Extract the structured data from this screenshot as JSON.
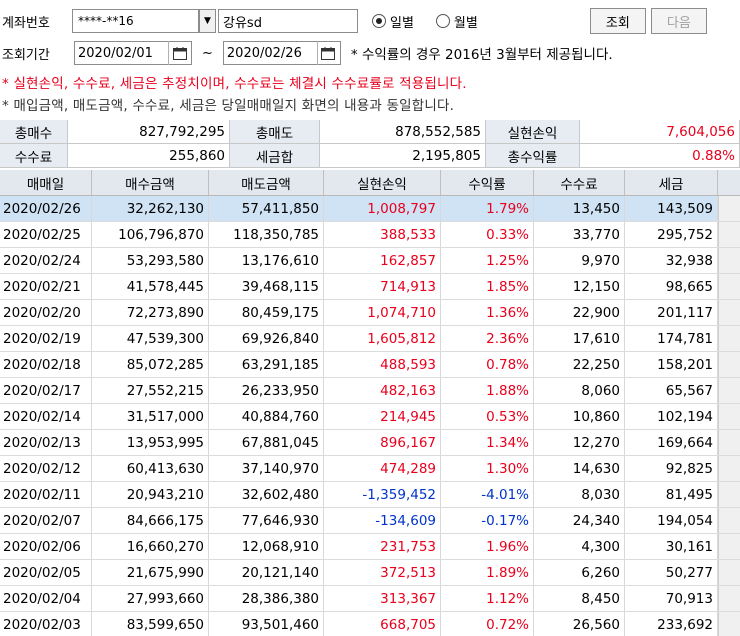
{
  "header": {
    "account_label": "계좌번호",
    "account_value": "****-**16",
    "account_name": "강유sd",
    "period_label": "조회기간",
    "date_from": "2020/02/01",
    "tilde": "~",
    "date_to": "2020/02/26",
    "radio_daily": "일별",
    "radio_monthly": "월별",
    "search_button": "조회",
    "next_button": "다음",
    "info_note": "* 수익률의 경우 2016년 3월부터 제공됩니다."
  },
  "notices": {
    "line1": "* 실현손익, 수수료, 세금은 추정치이며, 수수료는 체결시 수수료률로 적용됩니다.",
    "line2": "* 매입금액, 매도금액, 수수료, 세금은 당일매매일지 화면의 내용과 동일합니다."
  },
  "summary": {
    "total_buy_label": "총매수",
    "total_buy": "827,792,295",
    "total_sell_label": "총매도",
    "total_sell": "878,552,585",
    "realized_label": "실현손익",
    "realized": "7,604,056",
    "fee_label": "수수료",
    "fee": "255,860",
    "tax_label": "세금합",
    "tax": "2,195,805",
    "return_label": "총수익률",
    "return": "0.88%"
  },
  "table": {
    "headers": [
      "매매일",
      "매수금액",
      "매도금액",
      "실현손익",
      "수익률",
      "수수료",
      "세금"
    ],
    "rows": [
      [
        "2020/02/26",
        "32,262,130",
        "57,411,850",
        "1,008,797",
        "1.79%",
        "13,450",
        "143,509"
      ],
      [
        "2020/02/25",
        "106,796,870",
        "118,350,785",
        "388,533",
        "0.33%",
        "33,770",
        "295,752"
      ],
      [
        "2020/02/24",
        "53,293,580",
        "13,176,610",
        "162,857",
        "1.25%",
        "9,970",
        "32,938"
      ],
      [
        "2020/02/21",
        "41,578,445",
        "39,468,115",
        "714,913",
        "1.85%",
        "12,150",
        "98,665"
      ],
      [
        "2020/02/20",
        "72,273,890",
        "80,459,175",
        "1,074,710",
        "1.36%",
        "22,900",
        "201,117"
      ],
      [
        "2020/02/19",
        "47,539,300",
        "69,926,840",
        "1,605,812",
        "2.36%",
        "17,610",
        "174,781"
      ],
      [
        "2020/02/18",
        "85,072,285",
        "63,291,185",
        "488,593",
        "0.78%",
        "22,250",
        "158,201"
      ],
      [
        "2020/02/17",
        "27,552,215",
        "26,233,950",
        "482,163",
        "1.88%",
        "8,060",
        "65,567"
      ],
      [
        "2020/02/14",
        "31,517,000",
        "40,884,760",
        "214,945",
        "0.53%",
        "10,860",
        "102,194"
      ],
      [
        "2020/02/13",
        "13,953,995",
        "67,881,045",
        "896,167",
        "1.34%",
        "12,270",
        "169,664"
      ],
      [
        "2020/02/12",
        "60,413,630",
        "37,140,970",
        "474,289",
        "1.30%",
        "14,630",
        "92,825"
      ],
      [
        "2020/02/11",
        "20,943,210",
        "32,602,480",
        "-1,359,452",
        "-4.01%",
        "8,030",
        "81,495"
      ],
      [
        "2020/02/07",
        "84,666,175",
        "77,646,930",
        "-134,609",
        "-0.17%",
        "24,340",
        "194,054"
      ],
      [
        "2020/02/06",
        "16,660,270",
        "12,068,910",
        "231,753",
        "1.96%",
        "4,300",
        "30,161"
      ],
      [
        "2020/02/05",
        "21,675,990",
        "20,121,140",
        "372,513",
        "1.89%",
        "6,260",
        "50,277"
      ],
      [
        "2020/02/04",
        "27,993,660",
        "28,386,380",
        "313,367",
        "1.12%",
        "8,450",
        "70,913"
      ],
      [
        "2020/02/03",
        "83,599,650",
        "93,501,460",
        "668,705",
        "0.72%",
        "26,560",
        "233,692"
      ]
    ]
  },
  "colors": {
    "positive": "#e8001c",
    "negative": "#0033cc",
    "header_bg": "#e3e8ef",
    "selected_row": "#cfe3f4"
  }
}
